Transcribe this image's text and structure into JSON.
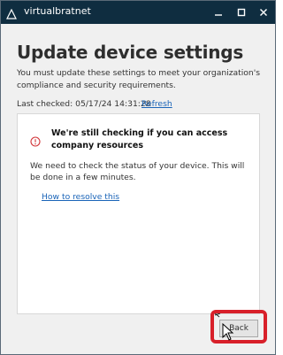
{
  "window": {
    "title": "virtualbratnet",
    "minimize_glyph": "▁",
    "maximize_glyph": "□",
    "close_glyph": "✕"
  },
  "page": {
    "heading": "Update device settings",
    "description": "You must update these settings to meet your organization's compliance and security requirements.",
    "last_checked": "Last checked: 05/17/24 14:31:28",
    "refresh_label": "Refresh"
  },
  "card": {
    "icon": "info-circle-icon",
    "title": "We're still checking if you can access company resources",
    "body": "We need to check the status of your device. This will be done in a few minutes.",
    "link": "How to resolve this"
  },
  "footer": {
    "back_label": "Back"
  },
  "colors": {
    "titlebar": "#0f2d40",
    "link": "#1a64b8",
    "highlight": "#d8202a",
    "info_icon": "#d13438"
  }
}
